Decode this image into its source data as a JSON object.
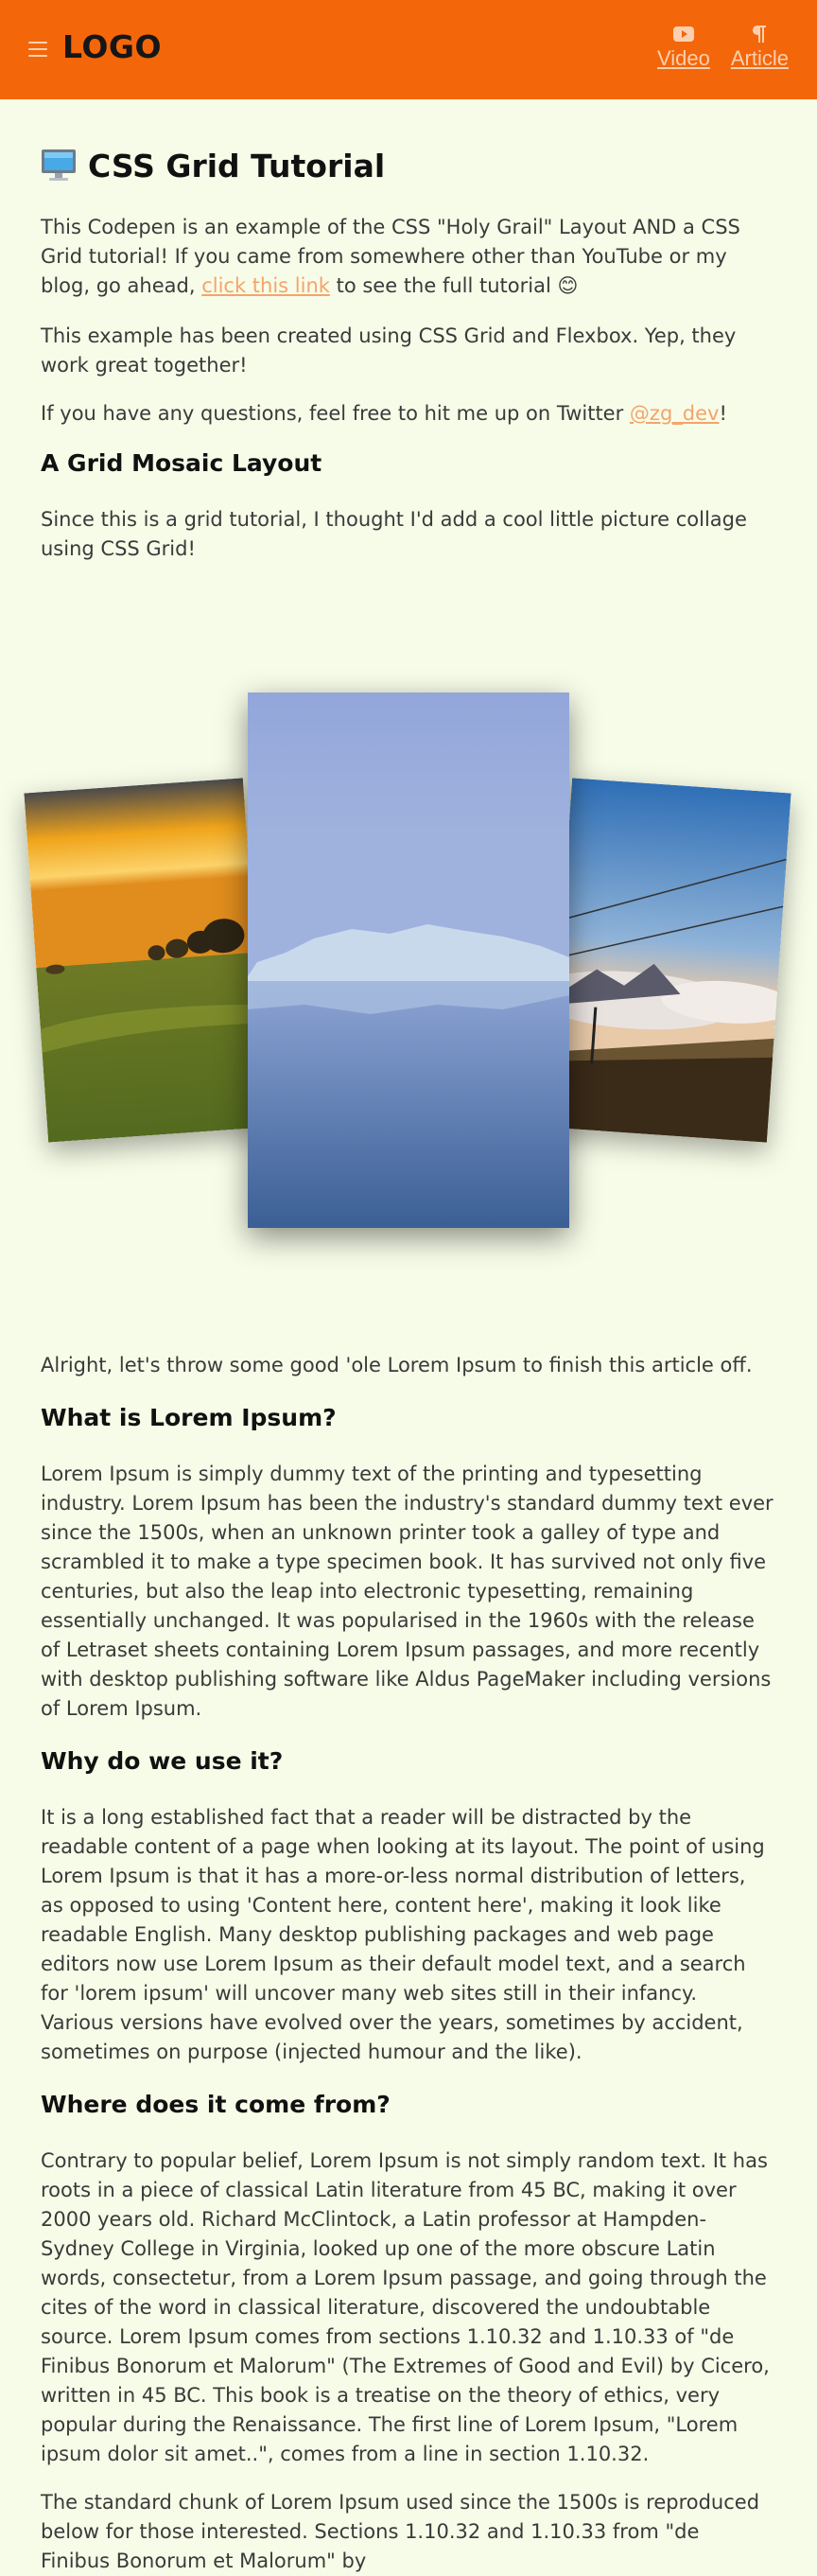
{
  "header": {
    "logo": "LOGO",
    "nav": [
      {
        "label": "Video",
        "icon": "youtube-icon"
      },
      {
        "label": "Article",
        "icon": "pilcrow-icon"
      }
    ],
    "menu_icon": "hamburger-icon",
    "background": "#f4660a"
  },
  "article": {
    "title": "CSS Grid Tutorial",
    "title_icon": "computer-monitor-icon",
    "intro_part1": "This Codepen is an example of the CSS \"Holy Grail\" Layout AND a CSS Grid tutorial! If you came from somewhere other than YouTube or my blog, go ahead, ",
    "intro_link": "click this link",
    "intro_part2": " to see the full tutorial ",
    "intro_emoji": "😊",
    "built_with": "This example has been created using CSS Grid and Flexbox. Yep, they work great together!",
    "questions_part1": "If you have any questions, feel free to hit me up on Twitter ",
    "twitter_handle": "@zg_dev",
    "questions_part2": "!",
    "mosaic_heading": "A Grid Mosaic Layout",
    "mosaic_text": "Since this is a grid tutorial, I thought I'd add a cool little picture collage using CSS Grid!",
    "lorem_intro": "Alright, let's throw some good 'ole Lorem Ipsum to finish this article off.",
    "sections": [
      {
        "heading": "What is Lorem Ipsum?",
        "paragraphs": [
          "Lorem Ipsum is simply dummy text of the printing and typesetting industry. Lorem Ipsum has been the industry's standard dummy text ever since the 1500s, when an unknown printer took a galley of type and scrambled it to make a type specimen book. It has survived not only five centuries, but also the leap into electronic typesetting, remaining essentially unchanged. It was popularised in the 1960s with the release of Letraset sheets containing Lorem Ipsum passages, and more recently with desktop publishing software like Aldus PageMaker including versions of Lorem Ipsum."
        ]
      },
      {
        "heading": "Why do we use it?",
        "paragraphs": [
          "It is a long established fact that a reader will be distracted by the readable content of a page when looking at its layout. The point of using Lorem Ipsum is that it has a more-or-less normal distribution of letters, as opposed to using 'Content here, content here', making it look like readable English. Many desktop publishing packages and web page editors now use Lorem Ipsum as their default model text, and a search for 'lorem ipsum' will uncover many web sites still in their infancy. Various versions have evolved over the years, sometimes by accident, sometimes on purpose (injected humour and the like)."
        ]
      },
      {
        "heading": "Where does it come from?",
        "paragraphs": [
          "Contrary to popular belief, Lorem Ipsum is not simply random text. It has roots in a piece of classical Latin literature from 45 BC, making it over 2000 years old. Richard McClintock, a Latin professor at Hampden-Sydney College in Virginia, looked up one of the more obscure Latin words, consectetur, from a Lorem Ipsum passage, and going through the cites of the word in classical literature, discovered the undoubtable source. Lorem Ipsum comes from sections 1.10.32 and 1.10.33 of \"de Finibus Bonorum et Malorum\" (The Extremes of Good and Evil) by Cicero, written in 45 BC. This book is a treatise on the theory of ethics, very popular during the Renaissance. The first line of Lorem Ipsum, \"Lorem ipsum dolor sit amet..\", comes from a line in section 1.10.32.",
          "The standard chunk of Lorem Ipsum used since the 1500s is reproduced below for those interested. Sections 1.10.32 and 1.10.33 from \"de Finibus Bonorum et Malorum\" by"
        ]
      }
    ]
  },
  "colors": {
    "accent": "#f4660a",
    "link": "#f3a46b",
    "page_background": "#f7fce8",
    "text": "#3a3a3a"
  }
}
